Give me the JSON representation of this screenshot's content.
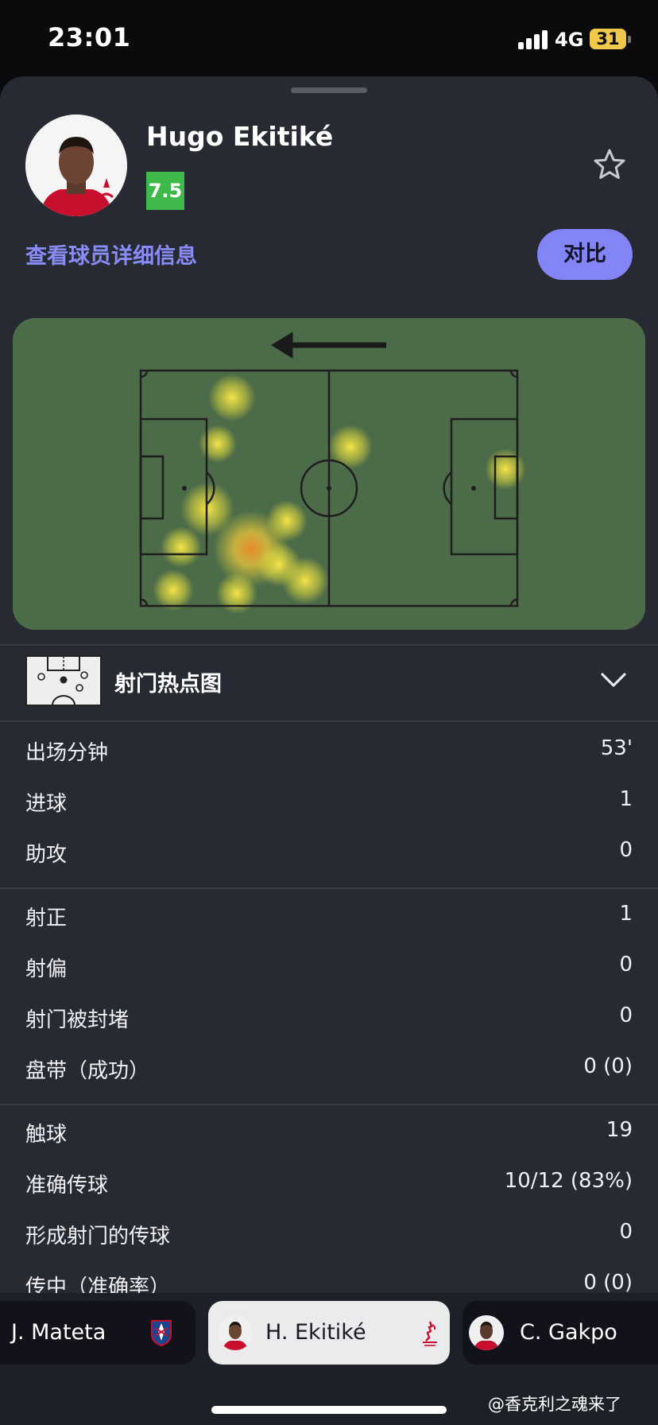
{
  "status_bar": {
    "time": "23:01",
    "network": "4G",
    "battery": "31"
  },
  "player": {
    "name": "Hugo Ekitiké",
    "rating": "7.5",
    "details_link": "查看球员详细信息",
    "compare_label": "对比"
  },
  "heatmap": {
    "direction": "left"
  },
  "shotmap": {
    "label": "射门热点图"
  },
  "stats": [
    {
      "label": "出场分钟",
      "value": "53'"
    },
    {
      "label": "进球",
      "value": "1"
    },
    {
      "label": "助攻",
      "value": "0"
    },
    {
      "label": "射正",
      "value": "1"
    },
    {
      "label": "射偏",
      "value": "0"
    },
    {
      "label": "射门被封堵",
      "value": "0"
    },
    {
      "label": "盘带（成功）",
      "value": "0 (0)"
    },
    {
      "label": "触球",
      "value": "19"
    },
    {
      "label": "准确传球",
      "value": "10/12 (83%)"
    },
    {
      "label": "形成射门的传球",
      "value": "0"
    },
    {
      "label": "传中（准确率）",
      "value": "0 (0)"
    }
  ],
  "player_tabs": [
    {
      "name": "J. Mateta",
      "active": false
    },
    {
      "name": "H. Ekitiké",
      "active": true
    },
    {
      "name": "C. Gakpo",
      "active": false
    }
  ],
  "watermark": "@香克利之魂来了",
  "colors": {
    "sheet_bg": "#282a33",
    "accent": "#8384f5",
    "link": "#8a8cf6",
    "rating_green": "#3fb94a",
    "pitch": "#4c6b49"
  }
}
